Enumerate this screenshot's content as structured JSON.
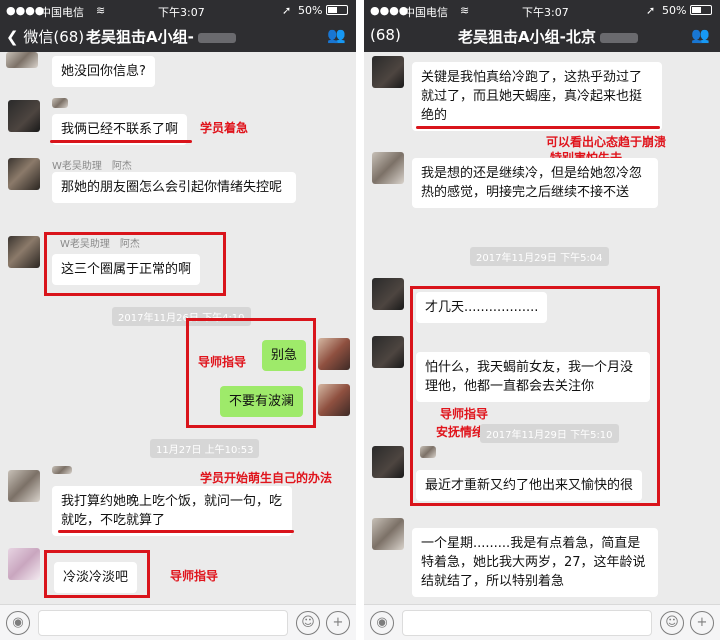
{
  "status": {
    "carrier": "中国电信",
    "time": "下午3:07",
    "battery": "50%",
    "wifi_icon": "wifi-icon",
    "location_icon": "location-icon"
  },
  "left": {
    "back_label": "微信(68)",
    "title": "老吴狙击A小组-",
    "messages": {
      "m1": "她没回你信息?",
      "m2": "我俩已经不联系了啊",
      "m3_sender": "W老吴助理　阿杰",
      "m3": "那她的朋友圈怎么会引起你情绪失控呢",
      "m4_sender": "W老吴助理　阿杰",
      "m4": "这三个圈属于正常的啊",
      "ts1": "2017年11月26日 下午4:10",
      "m5": "别急",
      "m6": "不要有波澜",
      "ts2": "11月27日 上午10:53",
      "m7": "我打算约她晚上吃个饭，就问一句，吃就吃，不吃就算了",
      "m8": "冷淡冷淡吧"
    },
    "annotations": {
      "a1": "学员着急",
      "a2": "导师指导",
      "a3": "学员开始萌生自己的办法",
      "a4": "导师指导"
    }
  },
  "right": {
    "back_label": "(68)",
    "title": "老吴狙击A小组-北京",
    "messages": {
      "m1": "关键是我怕真给冷跑了，这热乎劲过了就过了，而且她天蝎座，真冷起来也挺绝的",
      "m2": "我是想的还是继续冷，但是给她忽冷忽热的感觉，明接完之后继续不接不送",
      "ts1": "2017年11月29日 下午5:04",
      "m3": "才几天..................",
      "m4": "怕什么，我天蝎前女友，我一个月没理他，他都一直都会去关注你",
      "ts2": "2017年11月29日 下午5:10",
      "m5": "最近才重新又约了他出来又愉快的很",
      "m6": "一个星期.........我是有点着急，简直是特着急，她比我大两岁，27，这年龄说结就结了，所以特别着急"
    },
    "annotations": {
      "a1_line1": "可以看出心态趋于崩溃",
      "a1_line2": "特别害怕失去",
      "a2_line1": "导师指导",
      "a2_line2": "安抚情绪"
    }
  },
  "icons": {
    "back": "chevron-left-icon",
    "people": "people-icon",
    "voice": "voice-icon",
    "emoji": "emoji-icon",
    "plus": "plus-icon"
  },
  "colors": {
    "nav": "#2e2e31",
    "chat_bg": "#ebebeb",
    "green_bubble": "#9eea6a",
    "annotation_red": "#d9141b"
  }
}
